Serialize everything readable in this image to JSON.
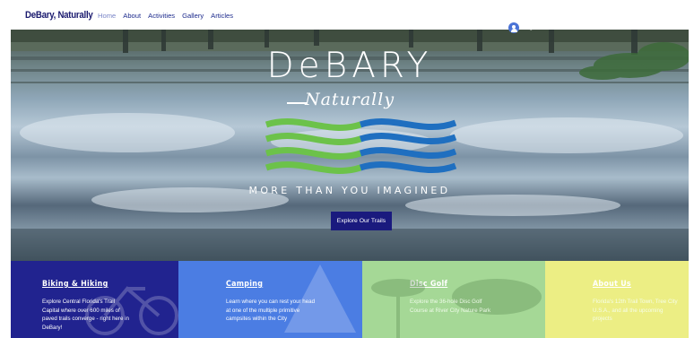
{
  "header": {
    "brand": "DeBary, Naturally",
    "nav": [
      "Home",
      "About",
      "Activities",
      "Gallery",
      "Articles"
    ],
    "login_label": "Log In"
  },
  "hero": {
    "title": "DeBARY",
    "subtitle": "Naturally",
    "tagline": "MORE THAN YOU IMAGINED",
    "cta": "Explore Our Trails",
    "logo_colors": {
      "green": "#6cc24a",
      "blue": "#1f6fc0"
    }
  },
  "cards": [
    {
      "title": "Biking & Hiking",
      "text": "Explore Central Florida's Trail Capital where over 600 miles of paved trails converge - right here in DeBary!",
      "color": "#21238f"
    },
    {
      "title": "Camping",
      "text": "Learn where you can rest your head at one of the multiple primitive campsites within the City",
      "color": "#4b7de3"
    },
    {
      "title": "Disc Golf",
      "text": "Explore the 36-hole Disc Golf Course at River City Nature Park",
      "color": "#a5d896"
    },
    {
      "title": "About Us",
      "text": "Florida's 12th Trail Town, Tree City U.S.A., and all the upcoming projects",
      "color": "#ecee84"
    }
  ]
}
